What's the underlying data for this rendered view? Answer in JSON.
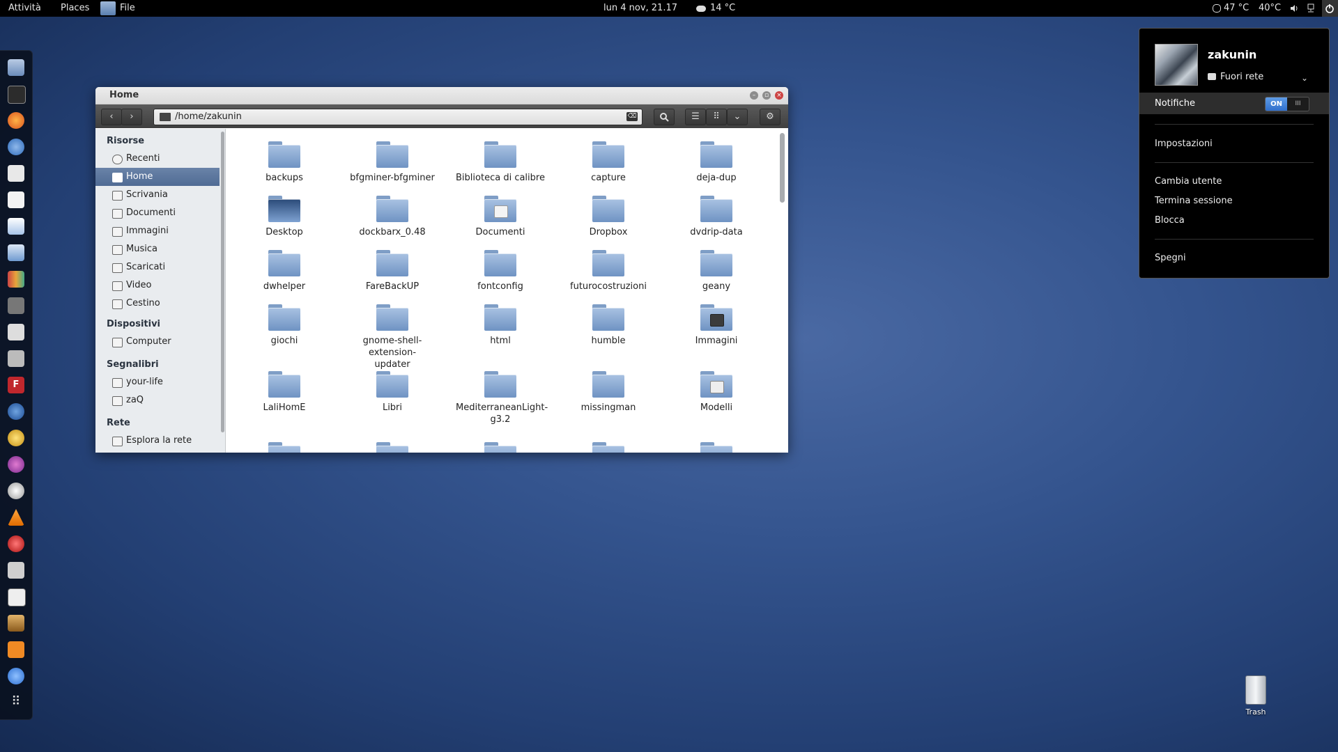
{
  "topbar": {
    "activities": "Attività",
    "places": "Places",
    "app_name": "File",
    "clock": "lun  4 nov, 21.17",
    "weather": "14 °C",
    "cpu_temp": "47 °C",
    "gpu_temp": "40°C"
  },
  "dock": {
    "icons": [
      "file-manager-icon",
      "terminal-icon",
      "firefox-icon",
      "chromium-icon",
      "home-icon",
      "text-editor-icon",
      "document-viewer-icon",
      "writer-icon",
      "library-icon",
      "game-icon",
      "inkscape-icon",
      "camera-icon",
      "filezilla-icon",
      "thunderbird-icon",
      "pidgin-icon",
      "sync-icon",
      "clock-app-icon",
      "vlc-icon",
      "media-icon",
      "scanner-icon",
      "calc-icon",
      "tools-icon",
      "settings-icon",
      "water-icon",
      "show-apps-icon"
    ]
  },
  "window": {
    "title": "Home",
    "path": "/home/zakunin",
    "sidebar": {
      "sections": [
        {
          "title": "Risorse",
          "items": [
            "Recenti",
            "Home",
            "Scrivania",
            "Documenti",
            "Immagini",
            "Musica",
            "Scaricati",
            "Video",
            "Cestino"
          ]
        },
        {
          "title": "Dispositivi",
          "items": [
            "Computer"
          ]
        },
        {
          "title": "Segnalibri",
          "items": [
            "your-life",
            "zaQ"
          ]
        },
        {
          "title": "Rete",
          "items": [
            "Esplora la rete"
          ]
        }
      ],
      "selected": "Home"
    },
    "files": [
      [
        "backups",
        "bfgminer-bfgminer",
        "Biblioteca di calibre",
        "capture",
        "deja-dup"
      ],
      [
        "Desktop",
        "dockbarx_0.48",
        "Documenti",
        "Dropbox",
        "dvdrip-data"
      ],
      [
        "dwhelper",
        "FareBackUP",
        "fontconfig",
        "futurocostruzioni",
        "geany"
      ],
      [
        "giochi",
        "gnome-shell-extension-updater",
        "html",
        "humble",
        "Immagini"
      ],
      [
        "LaliHomE",
        "Libri",
        "MediterraneanLight-g3.2",
        "missingman",
        "Modelli"
      ]
    ]
  },
  "usermenu": {
    "username": "zakunin",
    "status": "Fuori rete",
    "notifications_label": "Notifiche",
    "toggle_on": "ON",
    "toggle_off": "III",
    "settings": "Impostazioni",
    "switch_user": "Cambia utente",
    "logout": "Termina sessione",
    "lock": "Blocca",
    "shutdown": "Spegni"
  },
  "desktop": {
    "trash_label": "Trash"
  }
}
